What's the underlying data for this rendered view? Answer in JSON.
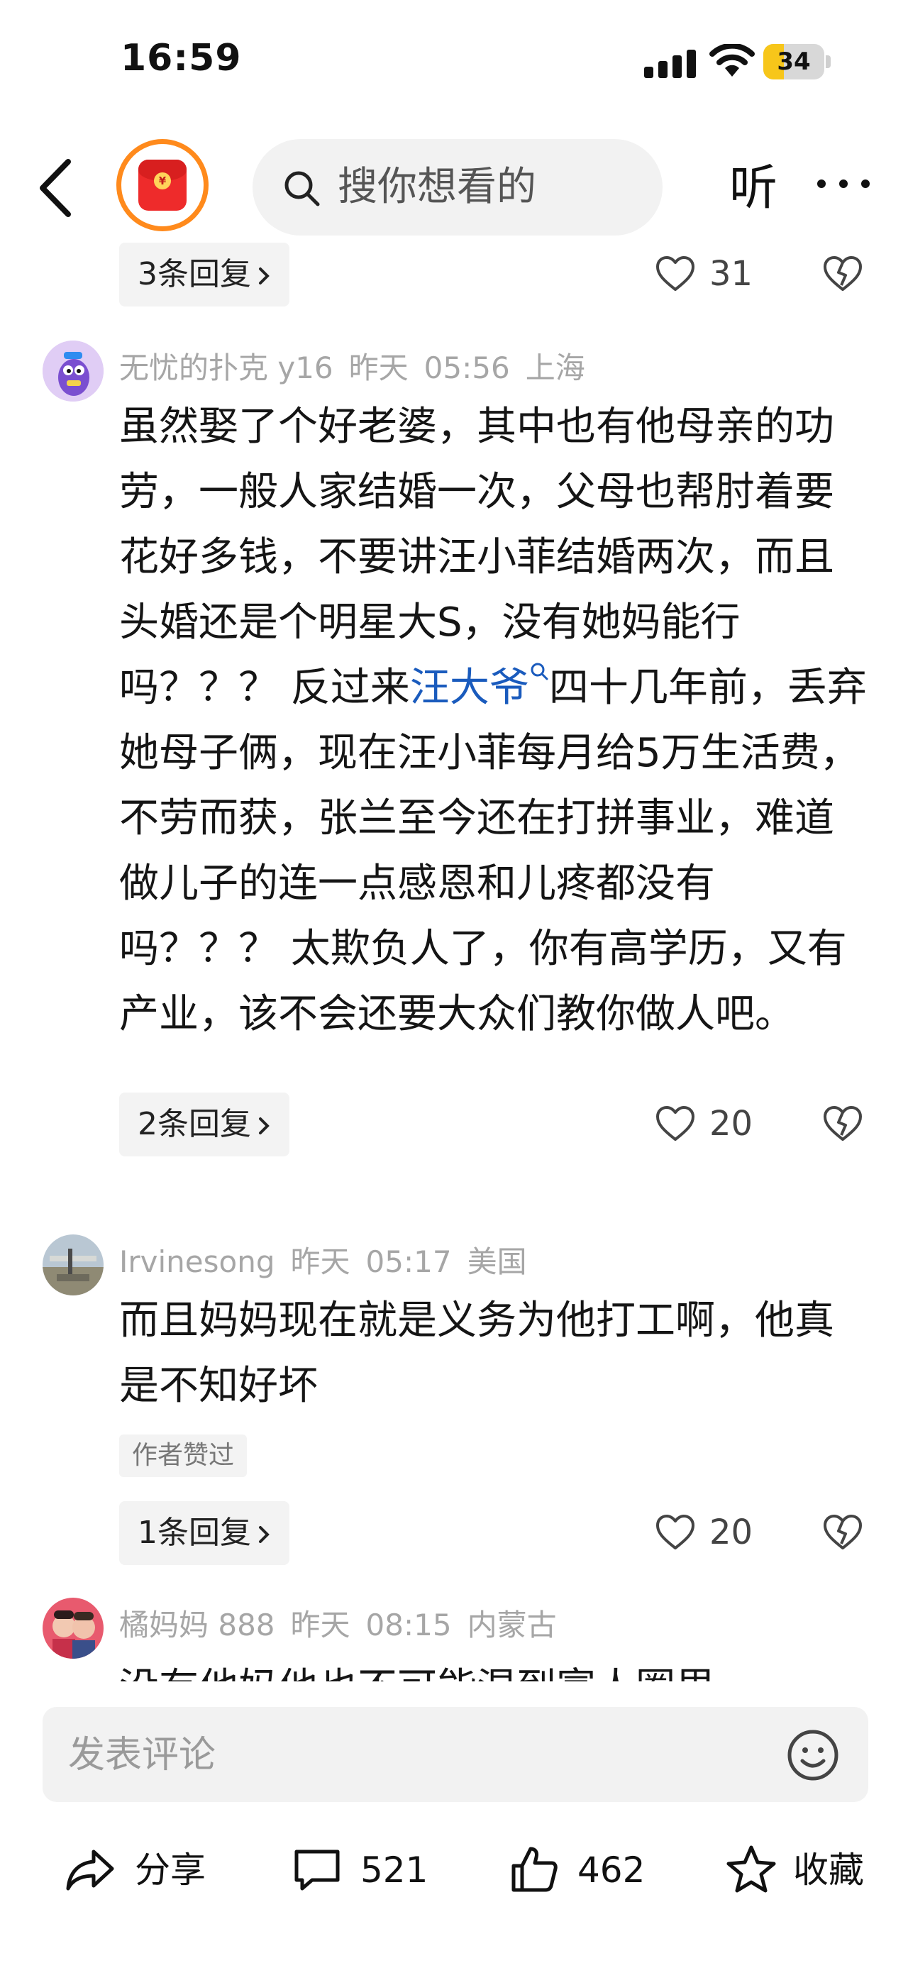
{
  "status_bar": {
    "time": "16:59",
    "battery_percent": 34,
    "battery_label": "34",
    "battery_color": "#f7c61a"
  },
  "nav": {
    "search_placeholder": "搜你想看的",
    "listen_label": "听",
    "accent_ring": "#ff8a1c"
  },
  "partial_comment": {
    "replies_label": "3条回复",
    "likes": "31"
  },
  "comments": [
    {
      "username": "无忧的扑克 y16",
      "date": "昨天",
      "time": "05:56",
      "location": "上海",
      "text_before_link": "虽然娶了个好老婆，其中也有他母亲的功劳，一般人家结婚一次，父母也帮肘着要花好多钱，不要讲汪小菲结婚两次，而且头婚还是个明星大S，没有她妈能行吗？？？ 反过来",
      "link_text": "汪大爷",
      "text_after_link": "四十几年前，丢弃她母子俩，现在汪小菲每月给5万生活费，不劳而获，张兰至今还在打拼事业，难道做儿子的连一点感恩和儿疼都没有吗？？？ 太欺负人了，你有高学历，又有产业，该不会还要大众们教你做人吧。",
      "replies_label": "2条回复",
      "likes": "20"
    },
    {
      "username": "Irvinesong",
      "date": "昨天",
      "time": "05:17",
      "location": "美国",
      "text": "而且妈妈现在就是义务为他打工啊，他真是不知好坏",
      "tag": "作者赞过",
      "replies_label": "1条回复",
      "likes": "20"
    },
    {
      "username": "橘妈妈 888",
      "date": "昨天",
      "time": "08:15",
      "location": "内蒙古",
      "text": "没有他妈他也不可能混到富人圈里"
    }
  ],
  "bottom": {
    "comment_placeholder": "发表评论",
    "share_label": "分享",
    "comment_count": "521",
    "like_count": "462",
    "favorite_label": "收藏"
  },
  "icons": {
    "back": "back-chevron-icon",
    "red_envelope": "red-envelope-icon",
    "search": "search-icon",
    "more": "more-dots-icon",
    "heart": "heart-icon",
    "dislike": "broken-heart-icon",
    "emoji": "emoji-icon",
    "share": "share-arrow-icon",
    "comment": "comment-bubble-icon",
    "thumb": "thumbs-up-icon",
    "star": "star-icon"
  },
  "colors": {
    "link": "#1a5bbd",
    "meta_text": "#a6a6a6",
    "reply_bg": "#f3f3f3"
  }
}
